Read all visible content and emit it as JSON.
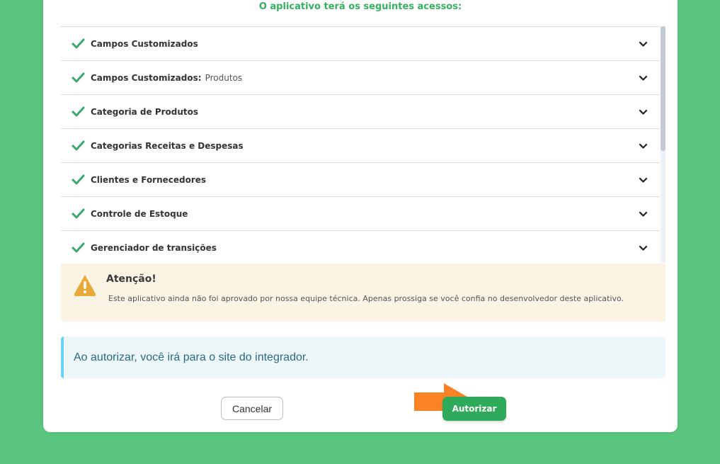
{
  "heading": "O aplicativo terá os seguintes acessos:",
  "permissions": [
    {
      "label": "Campos Customizados",
      "sub": ""
    },
    {
      "label": "Campos Customizados:",
      "sub": "Produtos"
    },
    {
      "label": "Categoria de Produtos",
      "sub": ""
    },
    {
      "label": "Categorias Receitas e Despesas",
      "sub": ""
    },
    {
      "label": "Clientes e Fornecedores",
      "sub": ""
    },
    {
      "label": "Controle de Estoque",
      "sub": ""
    },
    {
      "label": "Gerenciador de transições",
      "sub": ""
    }
  ],
  "icons": {
    "check": "check-icon",
    "chevron": "chevron-down-icon",
    "warning": "warning-icon",
    "arrow": "arrow-right-icon"
  },
  "warning": {
    "title": "Atenção!",
    "text": "Este aplicativo ainda não foi aprovado por nossa equipe técnica. Apenas prossiga se você confia no desenvolvedor deste aplicativo."
  },
  "info": {
    "text": "Ao autorizar, você irá para o site do integrador."
  },
  "buttons": {
    "cancel": "Cancelar",
    "authorize": "Autorizar"
  },
  "colors": {
    "background": "#5ac57e",
    "accent": "#2fa95a",
    "arrow": "#fa8325",
    "warning": "#e8a83a"
  }
}
